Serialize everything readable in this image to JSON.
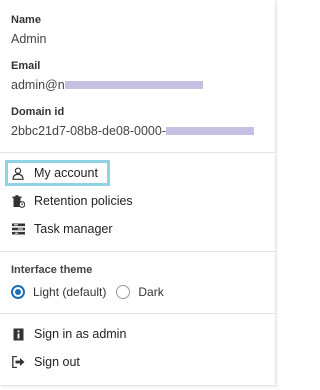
{
  "profile": {
    "name_label": "Name",
    "name_value": "Admin",
    "email_label": "Email",
    "email_value": "admin@n",
    "domain_label": "Domain id",
    "domain_value": "2bbc21d7-08b8-de08-0000-"
  },
  "menu": {
    "my_account": "My account",
    "retention_policies": "Retention policies",
    "task_manager": "Task manager"
  },
  "theme": {
    "title": "Interface theme",
    "options": [
      "Light (default)",
      "Dark"
    ],
    "selected": "Light (default)"
  },
  "footer": {
    "sign_in_admin": "Sign in as admin",
    "sign_out": "Sign out"
  },
  "colors": {
    "focus_outline": "#8fd3e6",
    "radio_accent": "#1d6fb8",
    "redaction": "#c7bfe3"
  },
  "icons": {
    "my_account": "user-icon",
    "retention_policies": "retention-icon",
    "task_manager": "task-manager-icon",
    "sign_in_admin": "admin-icon",
    "sign_out": "sign-out-icon"
  }
}
